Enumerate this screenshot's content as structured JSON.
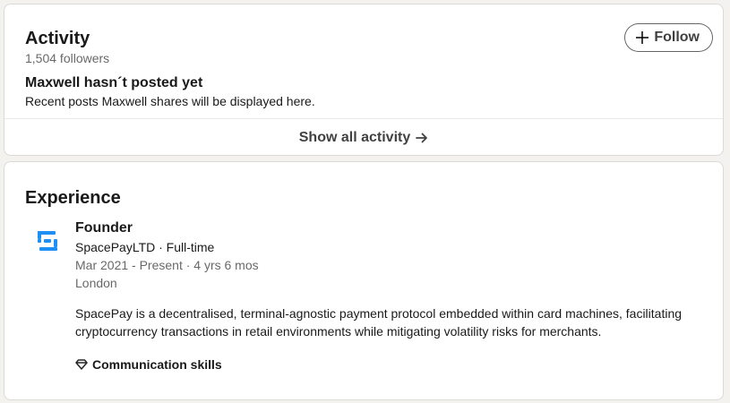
{
  "activity": {
    "title": "Activity",
    "followers": "1,504 followers",
    "follow_label": "Follow",
    "empty_title": "Maxwell hasn´t posted yet",
    "empty_subtitle": "Recent posts Maxwell shares will be displayed here.",
    "show_all_label": "Show all activity"
  },
  "experience": {
    "title": "Experience",
    "items": [
      {
        "role": "Founder",
        "company": "SpacePayLTD · Full-time",
        "dates": "Mar 2021 - Present · 4 yrs 6 mos",
        "location": "London",
        "description": "SpacePay is a decentralised, terminal-agnostic payment protocol embedded within card machines, facilitating cryptocurrency transactions in retail environments while mitigating volatility risks for merchants.",
        "skill": "Communication skills",
        "logo_icon": "spacepay-logo-icon"
      }
    ]
  },
  "colors": {
    "page_bg": "#f4f2ee",
    "card_bg": "#ffffff",
    "logo_blue": "#1e90f5"
  }
}
